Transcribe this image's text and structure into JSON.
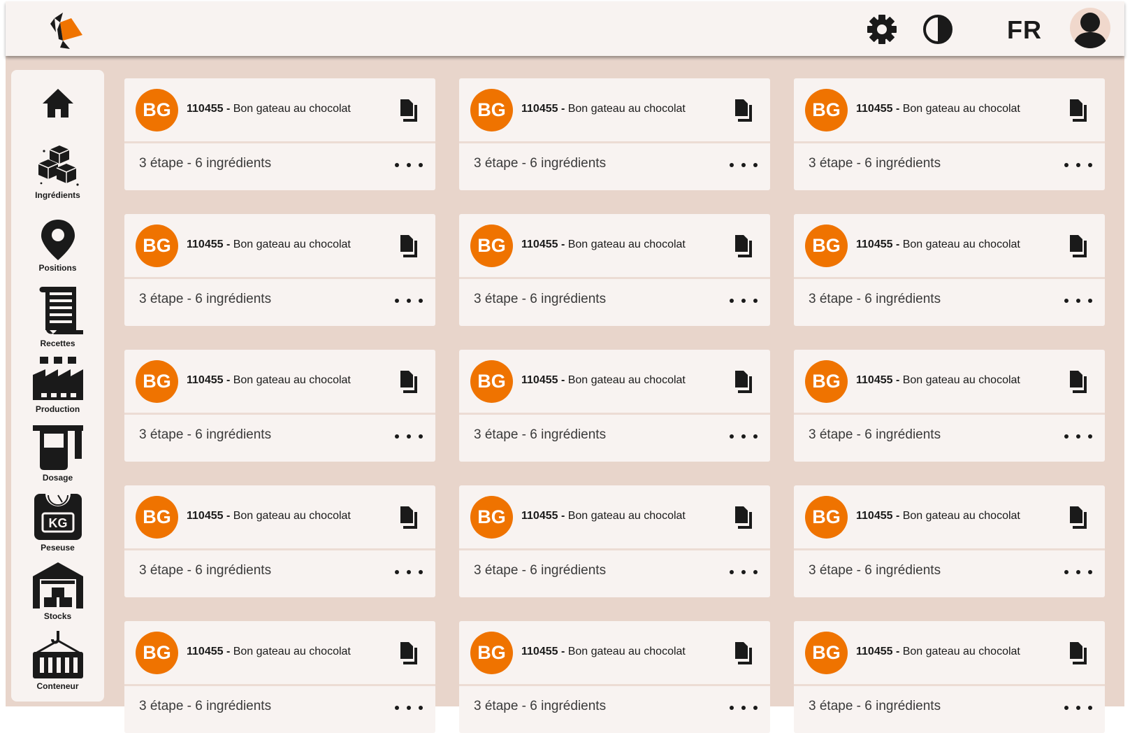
{
  "header": {
    "language_label": "FR",
    "icons": [
      "logo",
      "settings-gear-icon",
      "contrast-icon",
      "user-avatar-icon"
    ]
  },
  "sidebar": {
    "items": [
      {
        "id": "home",
        "label": "",
        "icon": "home-icon"
      },
      {
        "id": "ingredients",
        "label": "Ingrédients",
        "icon": "cubes-icon"
      },
      {
        "id": "positions",
        "label": "Positions",
        "icon": "map-pin-icon"
      },
      {
        "id": "recettes",
        "label": "Recettes",
        "icon": "scroll-icon"
      },
      {
        "id": "production",
        "label": "Production",
        "icon": "factory-icon"
      },
      {
        "id": "dosage",
        "label": "Dosage",
        "icon": "dosing-bucket-icon"
      },
      {
        "id": "peseuse",
        "label": "Peseuse",
        "icon": "scale-kg-icon"
      },
      {
        "id": "stocks",
        "label": "Stocks",
        "icon": "warehouse-icon"
      },
      {
        "id": "conteneur",
        "label": "Conteneur",
        "icon": "container-hook-icon"
      }
    ]
  },
  "colors": {
    "accent": "#ef7300",
    "header_bg": "#f8f3f1",
    "main_bg": "#e8d5cb",
    "card_bg": "#f8f3f1"
  },
  "recipes": [
    {
      "initials": "BG",
      "code": "110455",
      "separator": " - ",
      "name": "Bon gateau au chocolat",
      "summary": "3 étape - 6 ingrédients"
    },
    {
      "initials": "BG",
      "code": "110455",
      "separator": " - ",
      "name": "Bon gateau au chocolat",
      "summary": "3 étape - 6 ingrédients"
    },
    {
      "initials": "BG",
      "code": "110455",
      "separator": " - ",
      "name": "Bon gateau au chocolat",
      "summary": "3 étape - 6 ingrédients"
    },
    {
      "initials": "BG",
      "code": "110455",
      "separator": " - ",
      "name": "Bon gateau au chocolat",
      "summary": "3 étape - 6 ingrédients"
    },
    {
      "initials": "BG",
      "code": "110455",
      "separator": " - ",
      "name": "Bon gateau au chocolat",
      "summary": "3 étape - 6 ingrédients"
    },
    {
      "initials": "BG",
      "code": "110455",
      "separator": " - ",
      "name": "Bon gateau au chocolat",
      "summary": "3 étape - 6 ingrédients"
    },
    {
      "initials": "BG",
      "code": "110455",
      "separator": " - ",
      "name": "Bon gateau au chocolat",
      "summary": "3 étape - 6 ingrédients"
    },
    {
      "initials": "BG",
      "code": "110455",
      "separator": " - ",
      "name": "Bon gateau au chocolat",
      "summary": "3 étape - 6 ingrédients"
    },
    {
      "initials": "BG",
      "code": "110455",
      "separator": " - ",
      "name": "Bon gateau au chocolat",
      "summary": "3 étape - 6 ingrédients"
    },
    {
      "initials": "BG",
      "code": "110455",
      "separator": " - ",
      "name": "Bon gateau au chocolat",
      "summary": "3 étape - 6 ingrédients"
    },
    {
      "initials": "BG",
      "code": "110455",
      "separator": " - ",
      "name": "Bon gateau au chocolat",
      "summary": "3 étape - 6 ingrédients"
    },
    {
      "initials": "BG",
      "code": "110455",
      "separator": " - ",
      "name": "Bon gateau au chocolat",
      "summary": "3 étape - 6 ingrédients"
    },
    {
      "initials": "BG",
      "code": "110455",
      "separator": " - ",
      "name": "Bon gateau au chocolat",
      "summary": "3 étape - 6 ingrédients"
    },
    {
      "initials": "BG",
      "code": "110455",
      "separator": " - ",
      "name": "Bon gateau au chocolat",
      "summary": "3 étape - 6 ingrédients"
    },
    {
      "initials": "BG",
      "code": "110455",
      "separator": " - ",
      "name": "Bon gateau au chocolat",
      "summary": "3 étape - 6 ingrédients"
    }
  ]
}
